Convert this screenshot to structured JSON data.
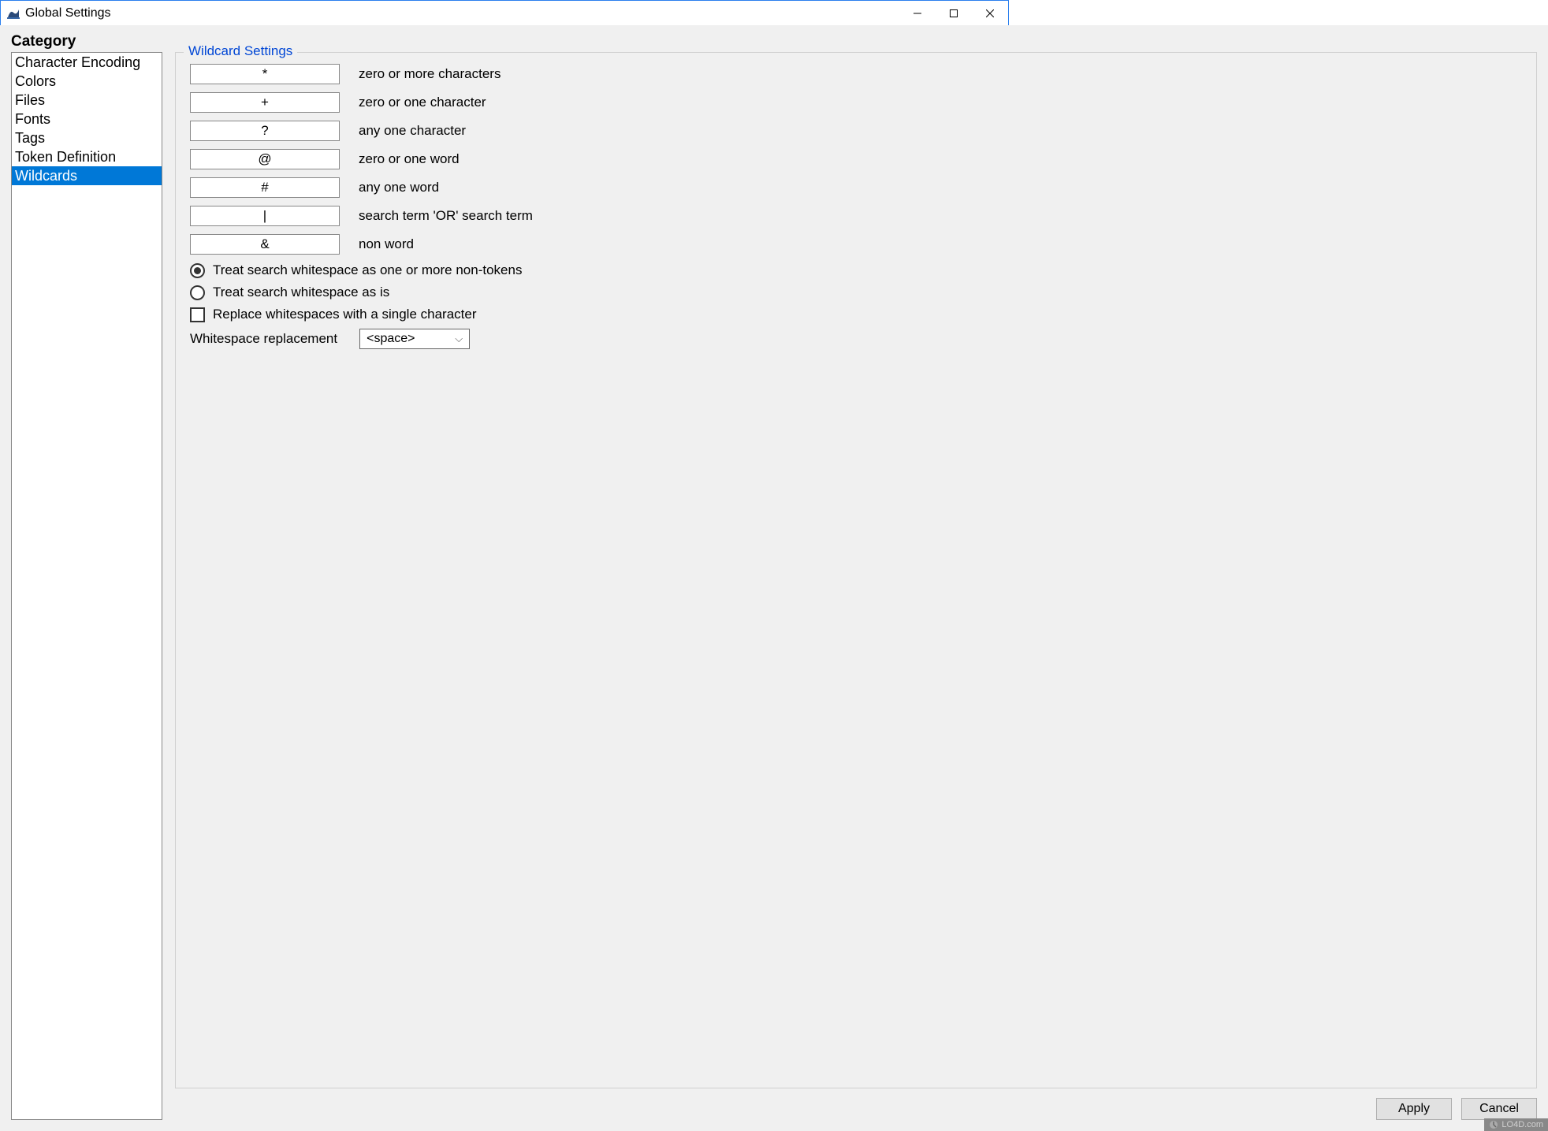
{
  "window": {
    "title": "Global Settings"
  },
  "sidebar": {
    "heading": "Category",
    "items": [
      {
        "label": "Character Encoding",
        "selected": false
      },
      {
        "label": "Colors",
        "selected": false
      },
      {
        "label": "Files",
        "selected": false
      },
      {
        "label": "Fonts",
        "selected": false
      },
      {
        "label": "Tags",
        "selected": false
      },
      {
        "label": "Token Definition",
        "selected": false
      },
      {
        "label": "Wildcards",
        "selected": true
      }
    ]
  },
  "panel": {
    "legend": "Wildcard Settings",
    "wildcards": [
      {
        "value": "*",
        "desc": "zero or more characters"
      },
      {
        "value": "+",
        "desc": "zero or one character"
      },
      {
        "value": "?",
        "desc": "any one character"
      },
      {
        "value": "@",
        "desc": "zero or one word"
      },
      {
        "value": "#",
        "desc": "any one word"
      },
      {
        "value": "|",
        "desc": "search term 'OR' search term"
      },
      {
        "value": "&",
        "desc": "non word"
      }
    ],
    "radio1": "Treat search whitespace as one or more non-tokens",
    "radio2": "Treat search whitespace as is",
    "radioSelected": 1,
    "checkbox1": "Replace whitespaces with a single character",
    "checkboxChecked": false,
    "whitespaceLabel": "Whitespace replacement",
    "whitespaceValue": "<space>"
  },
  "buttons": {
    "apply": "Apply",
    "cancel": "Cancel"
  },
  "watermark": "LO4D.com"
}
